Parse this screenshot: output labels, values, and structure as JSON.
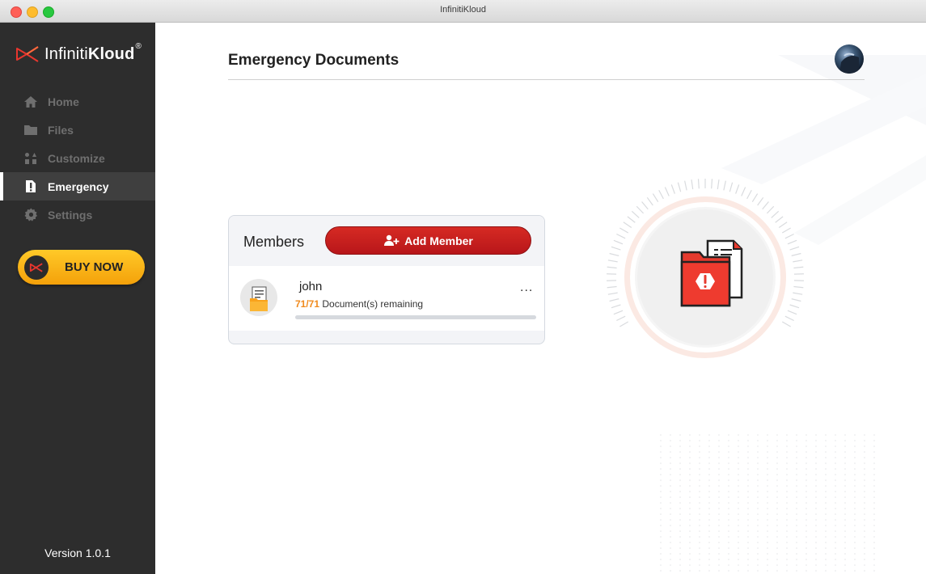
{
  "window": {
    "title": "InfinitiKloud"
  },
  "brand": {
    "name_light": "Infiniti",
    "name_bold": "Kloud",
    "reg": "®"
  },
  "sidebar": {
    "items": [
      {
        "label": "Home",
        "icon": "home-icon",
        "active": false
      },
      {
        "label": "Files",
        "icon": "folder-icon",
        "active": false
      },
      {
        "label": "Customize",
        "icon": "customize-icon",
        "active": false
      },
      {
        "label": "Emergency",
        "icon": "emergency-icon",
        "active": true
      },
      {
        "label": "Settings",
        "icon": "gear-icon",
        "active": false
      }
    ],
    "buy_now": "BUY NOW",
    "version": "Version 1.0.1"
  },
  "header": {
    "title": "Emergency Documents"
  },
  "members": {
    "label": "Members",
    "add_button": "Add Member",
    "list": [
      {
        "name": "john",
        "remaining_count": "71/71",
        "remaining_text": "Document(s) remaining",
        "progress": 0,
        "more": "..."
      }
    ]
  },
  "colors": {
    "accent_red": "#c41e1c",
    "buy_yellow": "#f8b51a",
    "count_orange": "#f08a1c",
    "sidebar_bg": "#2d2d2d"
  }
}
